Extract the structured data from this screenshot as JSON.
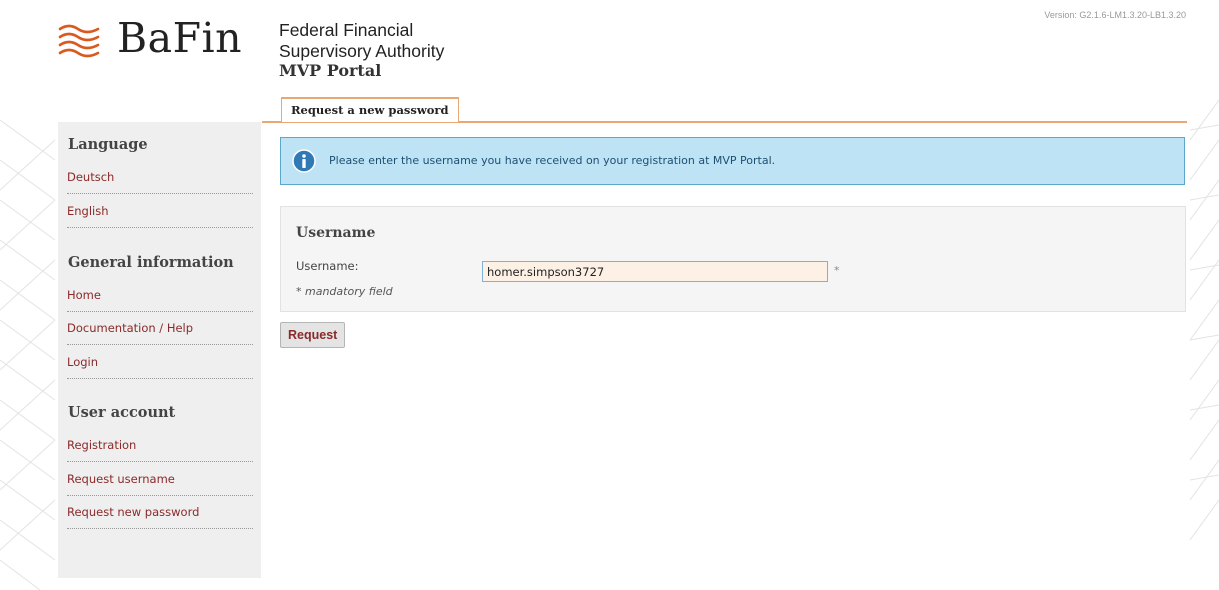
{
  "header": {
    "logo_text": "BaFin",
    "org_line1": "Federal Financial",
    "org_line2": "Supervisory Authority",
    "portal_title": "MVP Portal",
    "version": "Version: G2.1.6-LM1.3.20-LB1.3.20"
  },
  "tabs": [
    {
      "label": "Request a new password",
      "active": true
    }
  ],
  "sidebar": {
    "language_heading": "Language",
    "language_items": [
      {
        "label": "Deutsch"
      },
      {
        "label": "English"
      }
    ],
    "general_heading": "General information",
    "general_items": [
      {
        "label": "Home"
      },
      {
        "label": "Documentation / Help"
      },
      {
        "label": "Login"
      }
    ],
    "account_heading": "User account",
    "account_items": [
      {
        "label": "Registration"
      },
      {
        "label": "Request username"
      },
      {
        "label": "Request new password"
      }
    ]
  },
  "info": {
    "icon": "info-icon",
    "text": "Please enter the username you have received on your registration at MVP Portal."
  },
  "form": {
    "section_heading": "Username",
    "username_label": "Username:",
    "username_value": "homer.simpson3727",
    "required_marker": "*",
    "mandatory_note": "* mandatory field",
    "submit_label": "Request"
  },
  "colors": {
    "accent": "#e8a874",
    "link": "#8b2a2a",
    "info_bg": "#bde3f5",
    "info_border": "#5ba7c9",
    "sidebar_bg": "#efefef"
  }
}
